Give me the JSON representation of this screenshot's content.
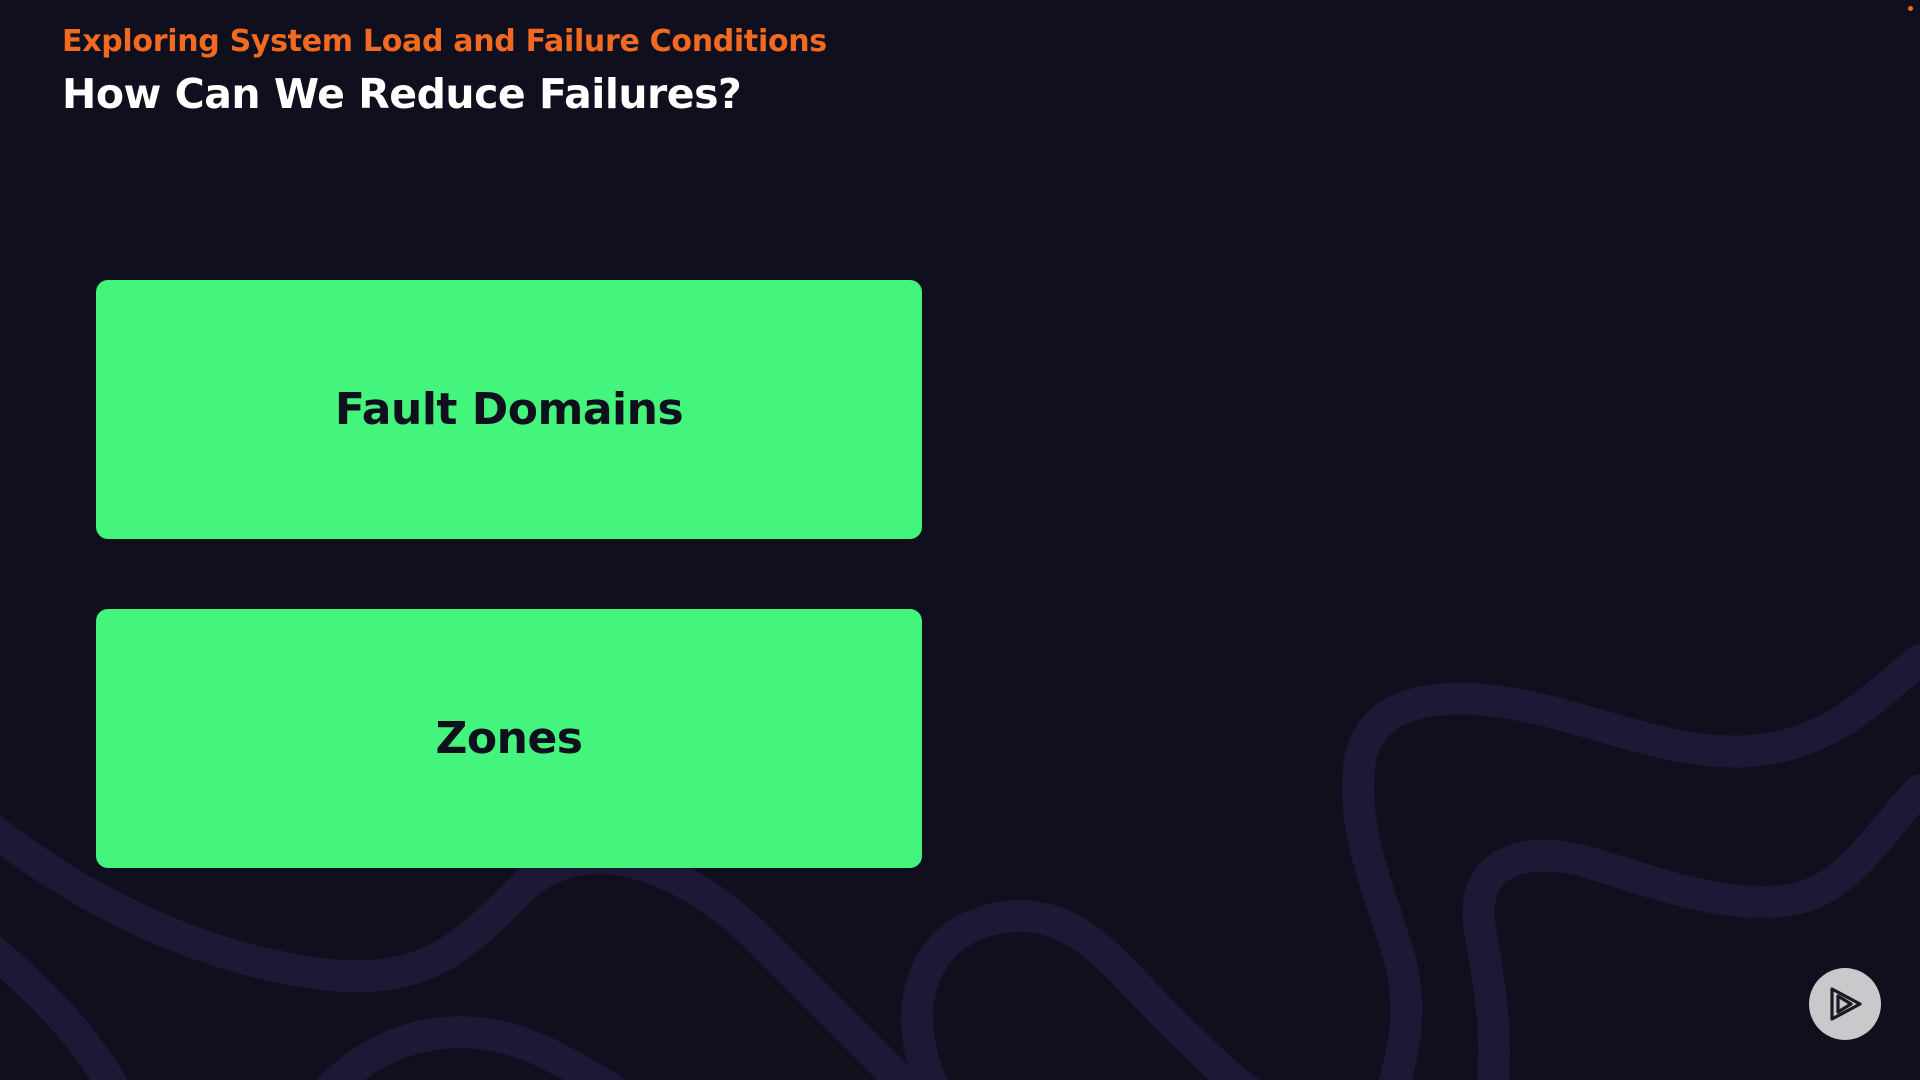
{
  "slide": {
    "subtitle": "Exploring System Load and Failure Conditions",
    "title": "How Can We Reduce Failures?"
  },
  "cards": [
    {
      "label": "Fault Domains"
    },
    {
      "label": "Zones"
    }
  ],
  "icons": {
    "play": "play-logo-icon"
  },
  "colors": {
    "background": "#0f0f1d",
    "accent_orange": "#f26a21",
    "card_green": "#43f57d",
    "title_white": "#ffffff",
    "swirl": "#1c1836"
  }
}
